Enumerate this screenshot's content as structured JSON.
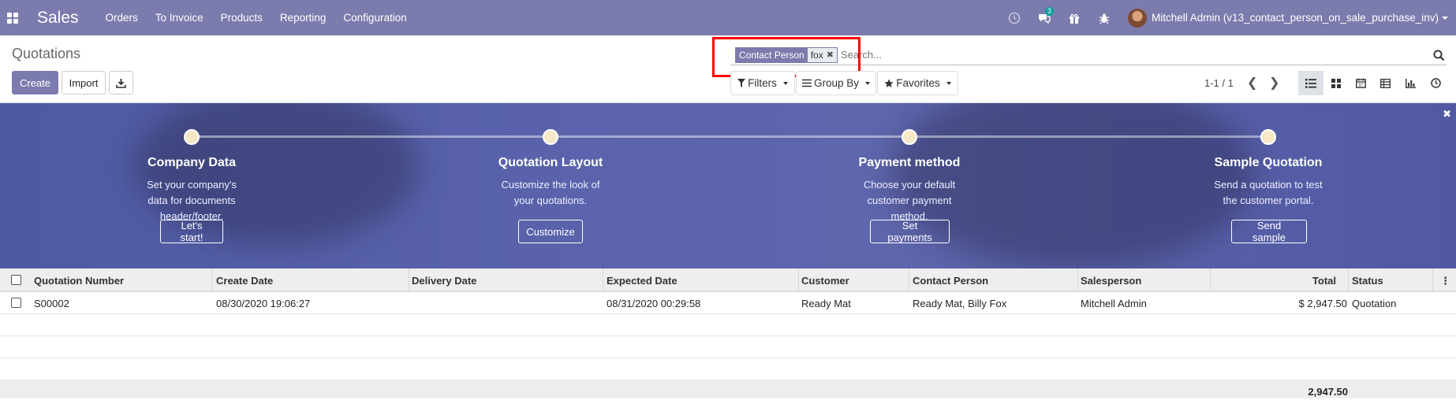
{
  "navbar": {
    "brand": "Sales",
    "menu": [
      "Orders",
      "To Invoice",
      "Products",
      "Reporting",
      "Configuration"
    ],
    "messages_badge": "3",
    "user_name": "Mitchell Admin (v13_contact_person_on_sale_purchase_inv)"
  },
  "control": {
    "title": "Quotations",
    "create_label": "Create",
    "import_label": "Import",
    "search": {
      "facet_label": "Contact Person",
      "facet_value": "fox",
      "placeholder": "Search..."
    },
    "filters_label": "Filters",
    "groupby_label": "Group By",
    "favorites_label": "Favorites",
    "pager": "1-1 / 1"
  },
  "banner": {
    "steps": [
      {
        "title": "Company Data",
        "desc": "Set your company's data for documents header/footer.",
        "button": "Let's start!"
      },
      {
        "title": "Quotation Layout",
        "desc": "Customize the look of your quotations.",
        "button": "Customize"
      },
      {
        "title": "Payment method",
        "desc": "Choose your default customer payment method.",
        "button": "Set payments"
      },
      {
        "title": "Sample Quotation",
        "desc": "Send a quotation to test the customer portal.",
        "button": "Send sample"
      }
    ]
  },
  "table": {
    "headers": {
      "number": "Quotation Number",
      "create_date": "Create Date",
      "delivery_date": "Delivery Date",
      "expected_date": "Expected Date",
      "customer": "Customer",
      "contact_person": "Contact Person",
      "salesperson": "Salesperson",
      "total": "Total",
      "status": "Status"
    },
    "rows": [
      {
        "number": "S00002",
        "create_date": "08/30/2020 19:06:27",
        "delivery_date": "",
        "expected_date": "08/31/2020 00:29:58",
        "customer": "Ready Mat",
        "contact_person": "Ready Mat, Billy Fox",
        "salesperson": "Mitchell Admin",
        "total": "$ 2,947.50",
        "status": "Quotation"
      }
    ],
    "footer_total": "2,947.50"
  },
  "colors": {
    "brand": "#7c7bad",
    "highlight": "#ff0000"
  }
}
